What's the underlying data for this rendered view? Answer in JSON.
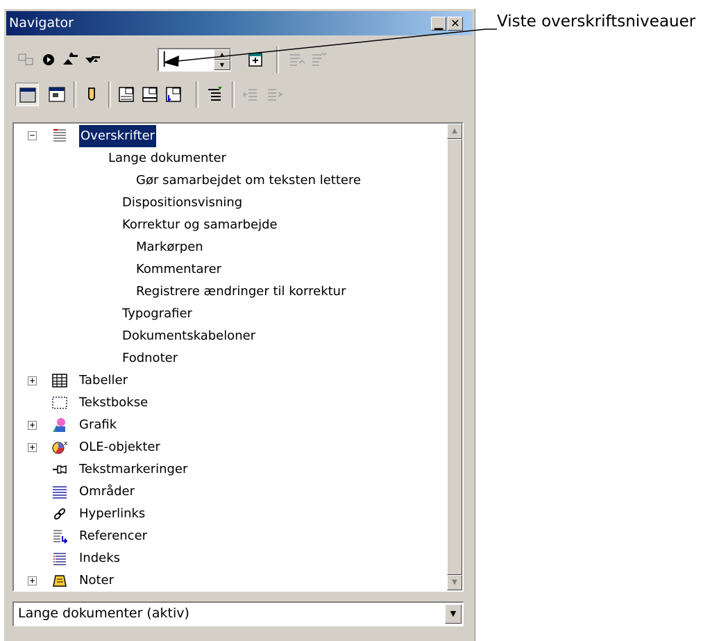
{
  "window": {
    "title": "Navigator",
    "minimize_icon": "minimize-icon",
    "close_icon": "close-icon"
  },
  "toolbar": {
    "heading_levels_value": "|",
    "row1_icons": [
      "navigation-toggle-icon",
      "navigate-icon",
      "previous-icon",
      "next-icon",
      "drag-mode-icon",
      "promote-chapter-icon",
      "demote-chapter-icon"
    ],
    "row2_icons": [
      "list-box-icon",
      "content-view-icon",
      "set-reminder-icon",
      "header-icon",
      "footer-icon",
      "anchor-endnote-icon",
      "promote-level-icon",
      "demote-level-icon"
    ]
  },
  "tree": {
    "items": [
      {
        "label": "Overskrifter",
        "expander": "⊟",
        "icon": "headings-icon",
        "selected": true
      },
      {
        "label": "Lange dokumenter"
      },
      {
        "label": "Gør samarbejdet om teksten lettere"
      },
      {
        "label": "Dispositionsvisning"
      },
      {
        "label": "Korrektur og samarbejde"
      },
      {
        "label": "Markørpen"
      },
      {
        "label": "Kommentarer"
      },
      {
        "label": "Registrere ændringer til korrektur"
      },
      {
        "label": "Typografier"
      },
      {
        "label": "Dokumentskabeloner"
      },
      {
        "label": "Fodnoter"
      },
      {
        "label": "Tabeller",
        "expander": "⊞",
        "icon": "table-icon"
      },
      {
        "label": "Tekstbokse",
        "icon": "textbox-icon"
      },
      {
        "label": "Grafik",
        "expander": "⊞",
        "icon": "graphics-icon"
      },
      {
        "label": "OLE-objekter",
        "expander": "⊞",
        "icon": "ole-object-icon"
      },
      {
        "label": "Tekstmarkeringer",
        "icon": "bookmark-icon"
      },
      {
        "label": "Områder",
        "icon": "sections-icon"
      },
      {
        "label": "Hyperlinks",
        "icon": "hyperlink-icon"
      },
      {
        "label": "Referencer",
        "icon": "references-icon"
      },
      {
        "label": "Indeks",
        "icon": "index-icon"
      },
      {
        "label": "Noter",
        "expander": "⊞",
        "icon": "notes-icon"
      }
    ]
  },
  "document_select": {
    "value": "Lange dokumenter (aktiv)"
  },
  "annotation": {
    "text": "Viste overskriftsniveauer"
  },
  "colors": {
    "titlebar": "#0a246a",
    "selection": "#0a246a",
    "face": "#d4d0c8"
  }
}
